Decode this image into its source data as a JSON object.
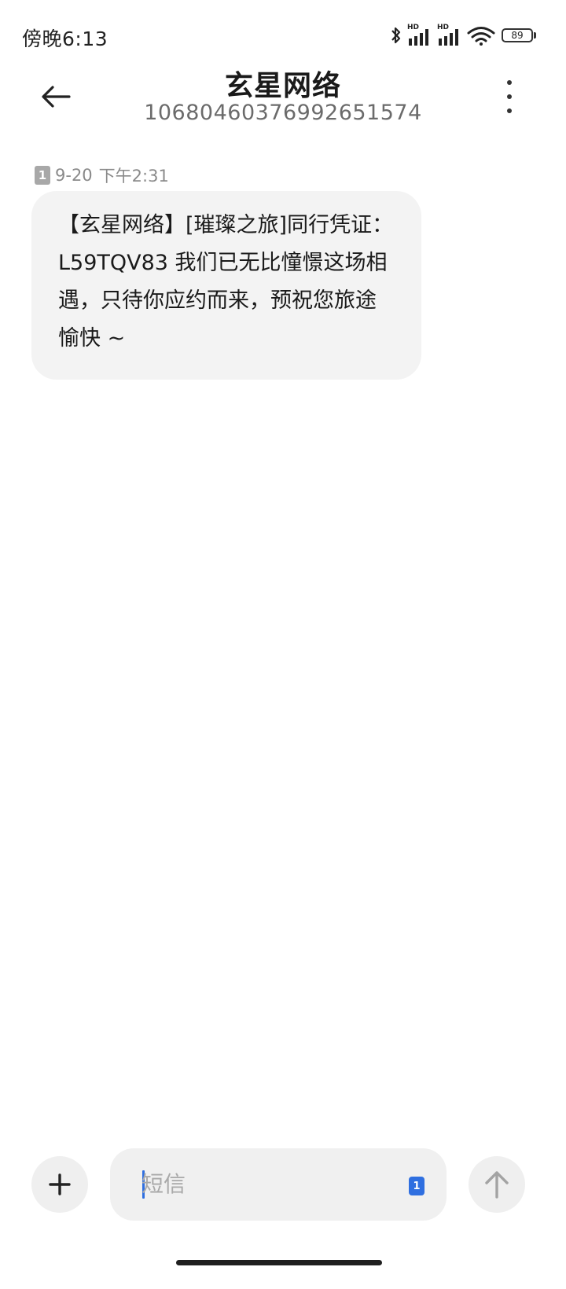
{
  "status_bar": {
    "time": "傍晚6:13",
    "battery": "89",
    "network_labels": [
      "HD",
      "HD"
    ],
    "icons": [
      "bluetooth-icon",
      "signal-icon",
      "signal-icon",
      "wifi-icon",
      "battery-icon"
    ]
  },
  "header": {
    "title": "玄星网络",
    "number": "10680460376992651574",
    "back_icon": "back-arrow-icon",
    "more_icon": "more-vertical-icon"
  },
  "messages": [
    {
      "sim": "1",
      "date": "9-20",
      "time": "下午2:31",
      "text": "【玄星网络】[璀璨之旅]同行凭证：L59TQV83 我们已无比憧憬这场相遇，只待你应约而来，预祝您旅途愉快 ~"
    }
  ],
  "composer": {
    "placeholder": "短信",
    "sim": "1",
    "add_icon": "plus-icon",
    "send_icon": "arrow-up-icon"
  },
  "colors": {
    "accent": "#2f6fe0",
    "bubble": "#f3f3f3",
    "background": "#ffffff"
  }
}
